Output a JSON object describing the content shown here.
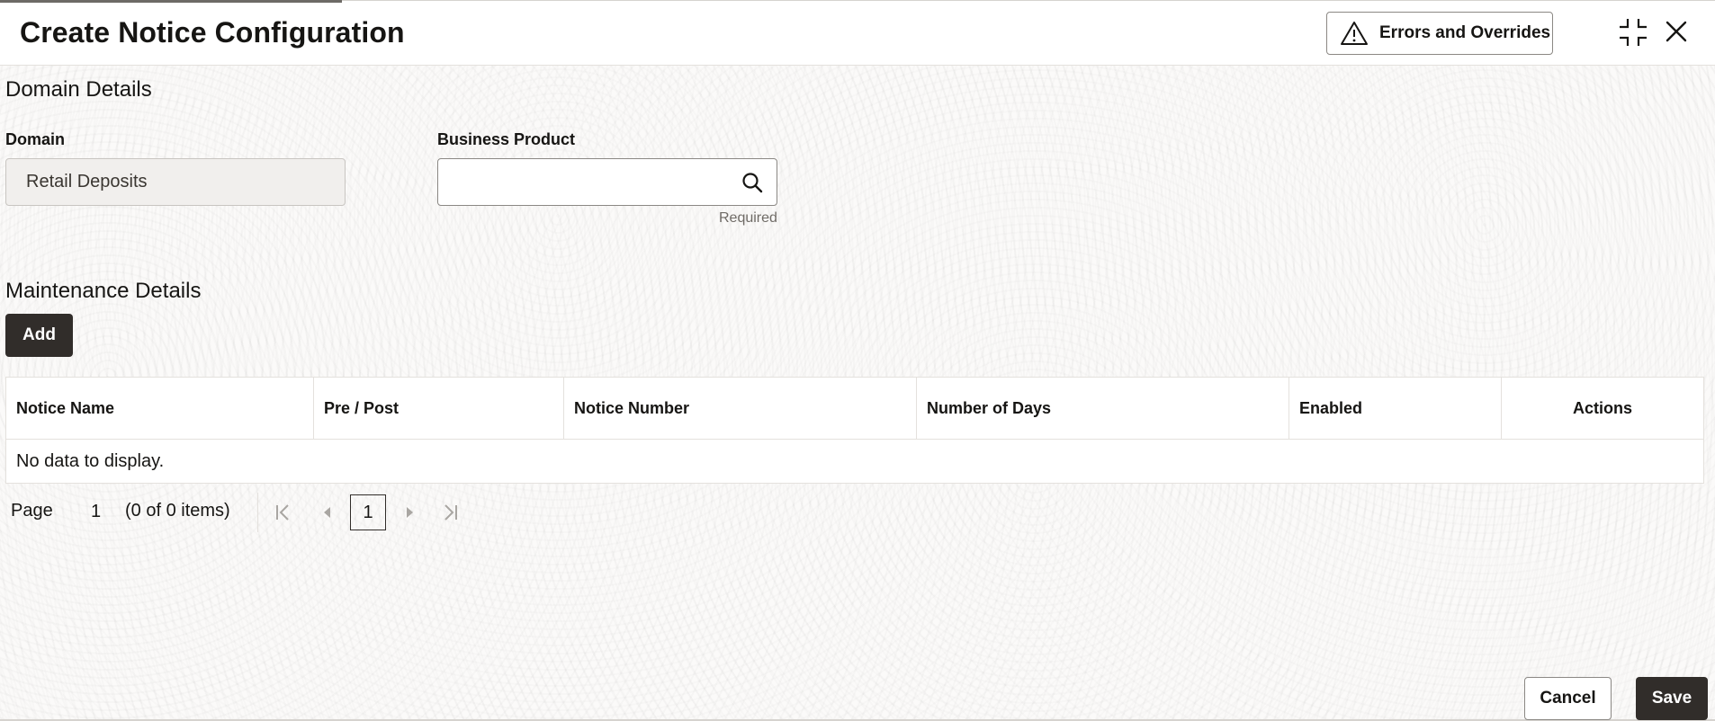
{
  "header": {
    "title": "Create Notice Configuration",
    "errors_button_label": "Errors and Overrides",
    "icons": {
      "warning": "warning-triangle-icon",
      "minimize": "minimize-icon",
      "close": "close-icon"
    }
  },
  "domain_details": {
    "section_title": "Domain Details",
    "domain": {
      "label": "Domain",
      "value": "Retail Deposits"
    },
    "business_product": {
      "label": "Business Product",
      "value": "",
      "placeholder": "",
      "hint": "Required"
    }
  },
  "maintenance_details": {
    "section_title": "Maintenance Details",
    "add_label": "Add",
    "columns": [
      "Notice Name",
      "Pre / Post",
      "Notice Number",
      "Number of Days",
      "Enabled",
      "Actions"
    ],
    "rows": [],
    "empty_text": "No data to display."
  },
  "pagination": {
    "page_label": "Page",
    "current_page": "1",
    "items_text": "(0 of 0 items)",
    "page_button": "1"
  },
  "footer": {
    "cancel_label": "Cancel",
    "save_label": "Save"
  },
  "colors": {
    "primary_button": "#312d2a",
    "text": "#161513",
    "border": "#8b8884"
  }
}
